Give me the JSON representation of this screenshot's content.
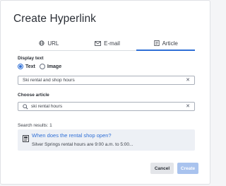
{
  "dialog": {
    "title": "Create Hyperlink"
  },
  "tabs": [
    {
      "label": "URL",
      "icon": "globe-icon",
      "active": false
    },
    {
      "label": "E-mail",
      "icon": "envelope-icon",
      "active": false
    },
    {
      "label": "Article",
      "icon": "article-icon",
      "active": true
    }
  ],
  "display_text": {
    "label": "Display text",
    "options": [
      "Text",
      "Image"
    ],
    "selected": "Text",
    "value": "Ski rental and shop hours",
    "clear_icon": "close-icon"
  },
  "choose_article": {
    "label": "Choose article",
    "search_value": "ski rental hours",
    "search_icon": "search-icon",
    "clear_icon": "close-icon"
  },
  "results": {
    "label": "Search results: 1",
    "items": [
      {
        "icon": "document-icon",
        "title": "When does the rental shop open?",
        "snippet": "Silver Springs rental hours are 9:00 a.m. to 5:00..."
      }
    ]
  },
  "buttons": {
    "cancel": "Cancel",
    "create": "Create"
  },
  "colors": {
    "accent": "#2f6fd6",
    "create_disabled": "#a9c3ee",
    "result_bg": "#edf0f5"
  }
}
